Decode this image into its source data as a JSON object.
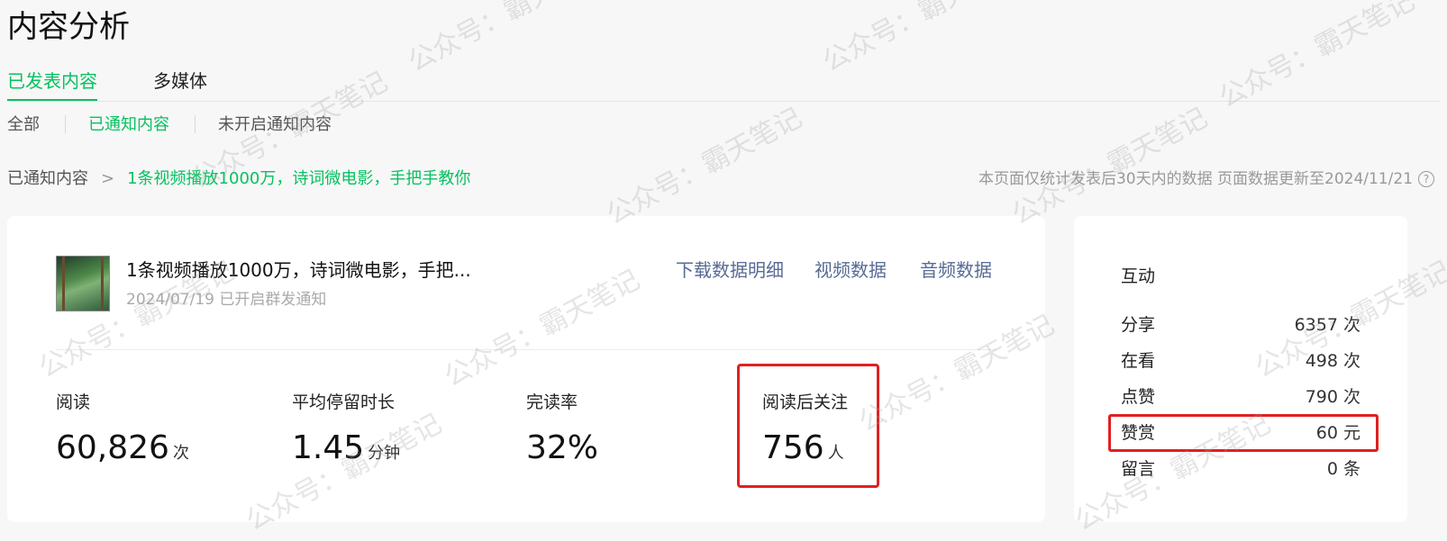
{
  "page": {
    "title": "内容分析"
  },
  "tabs": [
    {
      "label": "已发表内容",
      "active": true
    },
    {
      "label": "多媒体",
      "active": false
    }
  ],
  "subtabs": [
    {
      "label": "全部",
      "active": false
    },
    {
      "label": "已通知内容",
      "active": true
    },
    {
      "label": "未开启通知内容",
      "active": false
    }
  ],
  "breadcrumb": {
    "root": "已通知内容",
    "separator": ">",
    "current": "1条视频播放1000万，诗词微电影，手把手教你"
  },
  "note": {
    "text": "本页面仅统计发表后30天内的数据 页面数据更新至2024/11/21",
    "help_icon": "?"
  },
  "article": {
    "title": "1条视频播放1000万，诗词微电影，手把...",
    "subtitle": "2024/07/19 已开启群发通知",
    "links": [
      "下载数据明细",
      "视频数据",
      "音频数据"
    ]
  },
  "stats": [
    {
      "label": "阅读",
      "value": "60,826",
      "unit": "次"
    },
    {
      "label": "平均停留时长",
      "value": "1.45",
      "unit": "分钟"
    },
    {
      "label": "完读率",
      "value": "32%",
      "unit": ""
    },
    {
      "label": "阅读后关注",
      "value": "756",
      "unit": "人"
    }
  ],
  "interaction": {
    "title": "互动",
    "metrics": [
      {
        "label": "分享",
        "value": "6357 次"
      },
      {
        "label": "在看",
        "value": "498 次"
      },
      {
        "label": "点赞",
        "value": "790 次"
      },
      {
        "label": "赞赏",
        "value": "60 元"
      },
      {
        "label": "留言",
        "value": "0 条"
      }
    ]
  },
  "watermark": "公众号：霸天笔记",
  "colors": {
    "accent": "#07c160",
    "link": "#576b95",
    "highlight": "#e02020"
  }
}
